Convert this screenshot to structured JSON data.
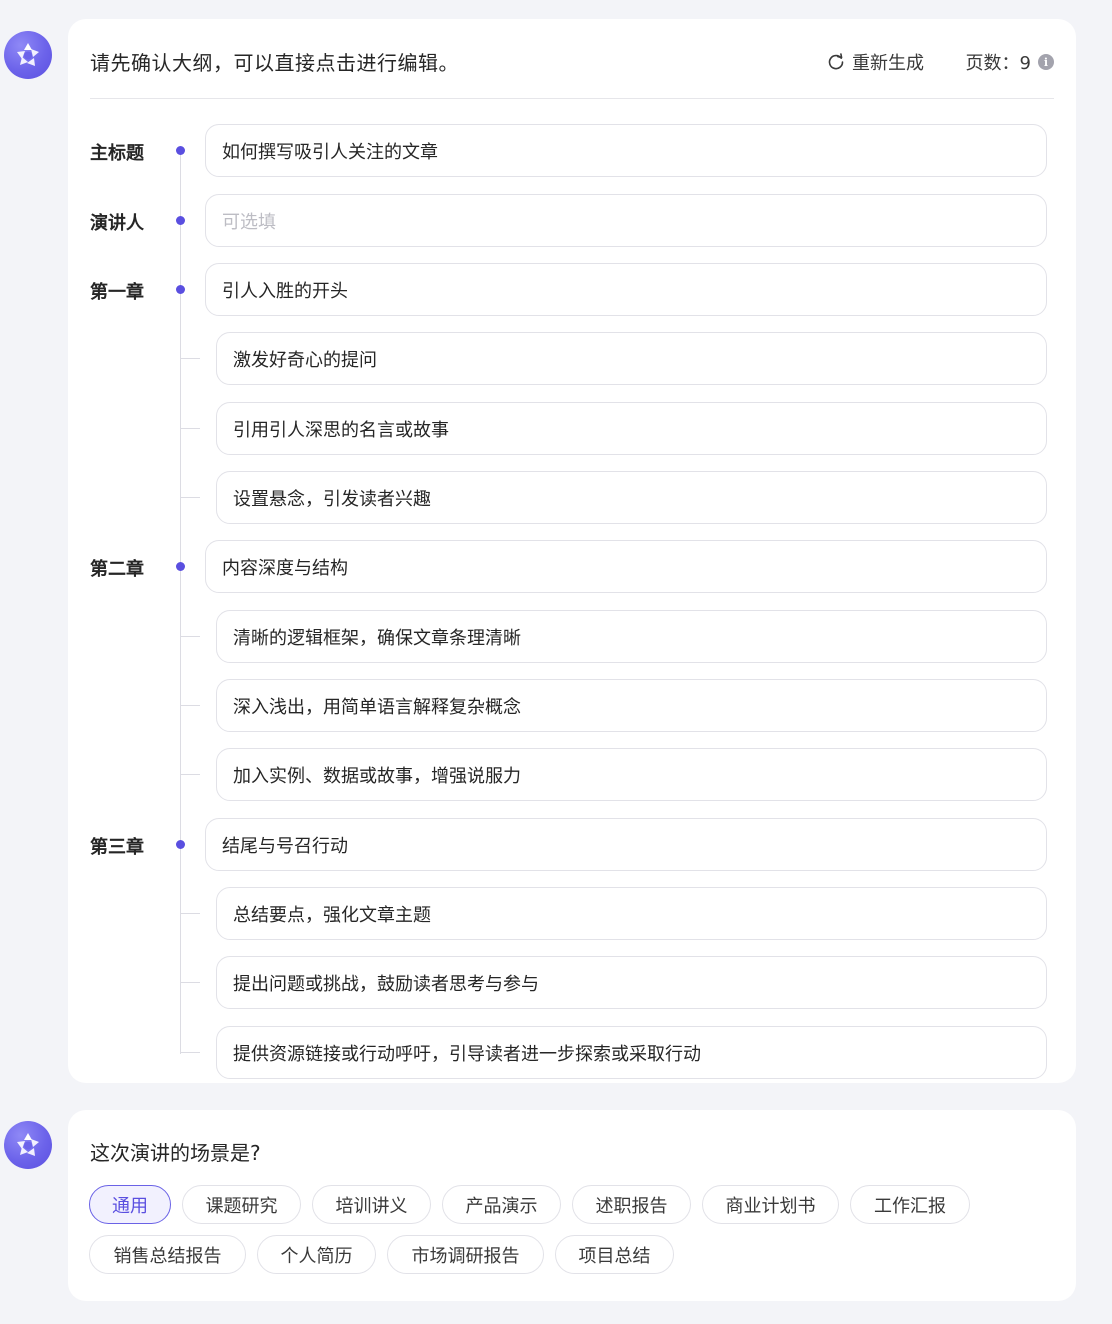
{
  "outline_card": {
    "header": {
      "title": "请先确认大纲，可以直接点击进行编辑。",
      "regenerate_label": "重新生成",
      "pages_label": "页数：9",
      "info_glyph": "i"
    },
    "rows": [
      {
        "label": "主标题",
        "value": "如何撰写吸引人关注的文章",
        "placeholder": "",
        "level": "main"
      },
      {
        "label": "演讲人",
        "value": "",
        "placeholder": "可选填",
        "level": "main"
      },
      {
        "label": "第一章",
        "value": "引人入胜的开头",
        "placeholder": "",
        "level": "main"
      },
      {
        "label": "",
        "value": "激发好奇心的提问",
        "placeholder": "",
        "level": "sub"
      },
      {
        "label": "",
        "value": "引用引人深思的名言或故事",
        "placeholder": "",
        "level": "sub"
      },
      {
        "label": "",
        "value": "设置悬念，引发读者兴趣",
        "placeholder": "",
        "level": "sub"
      },
      {
        "label": "第二章",
        "value": "内容深度与结构",
        "placeholder": "",
        "level": "main"
      },
      {
        "label": "",
        "value": "清晰的逻辑框架，确保文章条理清晰",
        "placeholder": "",
        "level": "sub"
      },
      {
        "label": "",
        "value": "深入浅出，用简单语言解释复杂概念",
        "placeholder": "",
        "level": "sub"
      },
      {
        "label": "",
        "value": "加入实例、数据或故事，增强说服力",
        "placeholder": "",
        "level": "sub"
      },
      {
        "label": "第三章",
        "value": "结尾与号召行动",
        "placeholder": "",
        "level": "main"
      },
      {
        "label": "",
        "value": "总结要点，强化文章主题",
        "placeholder": "",
        "level": "sub"
      },
      {
        "label": "",
        "value": "提出问题或挑战，鼓励读者思考与参与",
        "placeholder": "",
        "level": "sub"
      },
      {
        "label": "",
        "value": "提供资源链接或行动呼吁，引导读者进一步探索或采取行动",
        "placeholder": "",
        "level": "sub"
      }
    ]
  },
  "scene_card": {
    "question": "这次演讲的场景是?",
    "selected": "通用",
    "options": [
      "通用",
      "课题研究",
      "培训讲义",
      "产品演示",
      "述职报告",
      "商业计划书",
      "工作汇报",
      "销售总结报告",
      "个人简历",
      "市场调研报告",
      "项目总结"
    ]
  },
  "icons": {
    "avatar": "assistant-logo-icon",
    "regenerate": "refresh-icon",
    "info": "info-icon"
  },
  "colors": {
    "accent": "#5a4fe0",
    "background": "#f3f4f8",
    "card": "#ffffff",
    "border": "#e2e2e8"
  }
}
